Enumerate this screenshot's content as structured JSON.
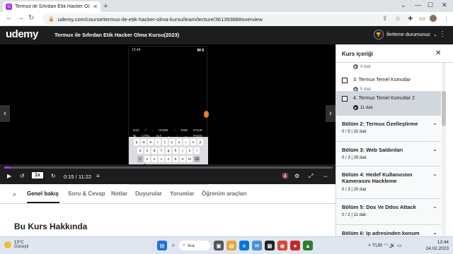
{
  "browser": {
    "tab_title": "Termux ile Sıfırdan Etik Hacker Ol...",
    "tab_icon": "udemy-favicon",
    "new_tab": "+",
    "url": "udemy.com/course/termux-ile-etik-hacker-olma-kursu/learn/lecture/36139388#overview"
  },
  "header": {
    "logo": "udemy",
    "course_title": "Termux ile Sıfırdan Etik Hacker Olma Kursu(2023)",
    "progress_label": "İlerleme durumunuz"
  },
  "player": {
    "phone_time": "13:44",
    "extra_keys_row1": [
      "ESC",
      "/",
      "-",
      "HOME",
      "↑",
      "END",
      "PGUP"
    ],
    "extra_keys_row2": [
      "↹",
      "CTRL",
      "ALT",
      "←",
      "↓",
      "→",
      "PGDN"
    ],
    "keyboard_rows": [
      [
        "q",
        "w",
        "e",
        "r",
        "t",
        "y",
        "u",
        "ı",
        "o",
        "p"
      ],
      [
        "a",
        "s",
        "d",
        "f",
        "g",
        "h",
        "j",
        "k",
        "l"
      ],
      [
        "⇧",
        "z",
        "x",
        "c",
        "v",
        "b",
        "n",
        "m",
        "⌫"
      ]
    ],
    "keyboard_bottom": [
      "?123",
      "☺",
      "Türkçe",
      ".",
      "↵"
    ],
    "speed": "1x",
    "time": "0:15 / 11:22",
    "progress_fraction": 0.02
  },
  "tabs": {
    "items": [
      "Genel bakış",
      "Soru & Cevap",
      "Notlar",
      "Duyurular",
      "Yorumlar",
      "Öğrenim araçları"
    ],
    "active": "Genel bakış"
  },
  "about_heading": "Bu Kurs Hakkında",
  "sidebar": {
    "title": "Kurs içeriği",
    "lectures": [
      {
        "name": "",
        "duration": "4 dak",
        "selected": false
      },
      {
        "name": "3. Termux Temel Komutlar",
        "duration": "5 dak",
        "selected": false
      },
      {
        "name": "4. Termux Temel Komutlar 2",
        "duration": "11 dak",
        "selected": true
      }
    ],
    "sections": [
      {
        "name": "Bölüm 2: Termux Özelleştirme",
        "meta": "0 / 5 | 32 dak"
      },
      {
        "name": "Bölüm 3: Web Saldırıları",
        "meta": "0 / 3 | 29 dak"
      },
      {
        "name": "Bölüm 4: Hedef Kullanıcının Kamerasını Hackleme",
        "meta": "0 / 3 | 20 dak"
      },
      {
        "name": "Bölüm 5: Dos Ve Ddos Attack",
        "meta": "0 / 2 | 11 dak"
      },
      {
        "name": "Bölüm 6: Ip adresinden konum",
        "meta": ""
      }
    ]
  },
  "taskbar": {
    "weather_temp": "13°C",
    "weather_text": "Güneşli",
    "search": "Ara",
    "tray_lang": "TUR",
    "time": "13:44",
    "date": "24.02.2023"
  },
  "colors": {
    "accent": "#a435f0",
    "dark": "#1c1d1f"
  }
}
